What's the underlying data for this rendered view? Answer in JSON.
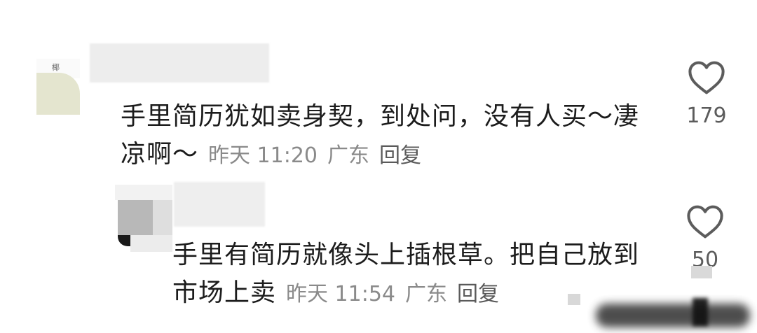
{
  "comments": [
    {
      "avatar_text": "椰",
      "text": "手里简历犹如卖身契，到处问，没有人买～凄凉啊～",
      "time": "昨天 11:20",
      "location": "广东",
      "reply_label": "回复",
      "likes": "179"
    },
    {
      "text": "手里有简历就像头上插根草。把自己放到市场上卖",
      "time": "昨天 11:54",
      "location": "广东",
      "reply_label": "回复",
      "likes": "50"
    }
  ],
  "icons": {
    "like": "heart-outline-icon"
  },
  "colors": {
    "text": "#1c1c1c",
    "meta": "#8a8a8a",
    "icon": "#5c5c5c"
  }
}
